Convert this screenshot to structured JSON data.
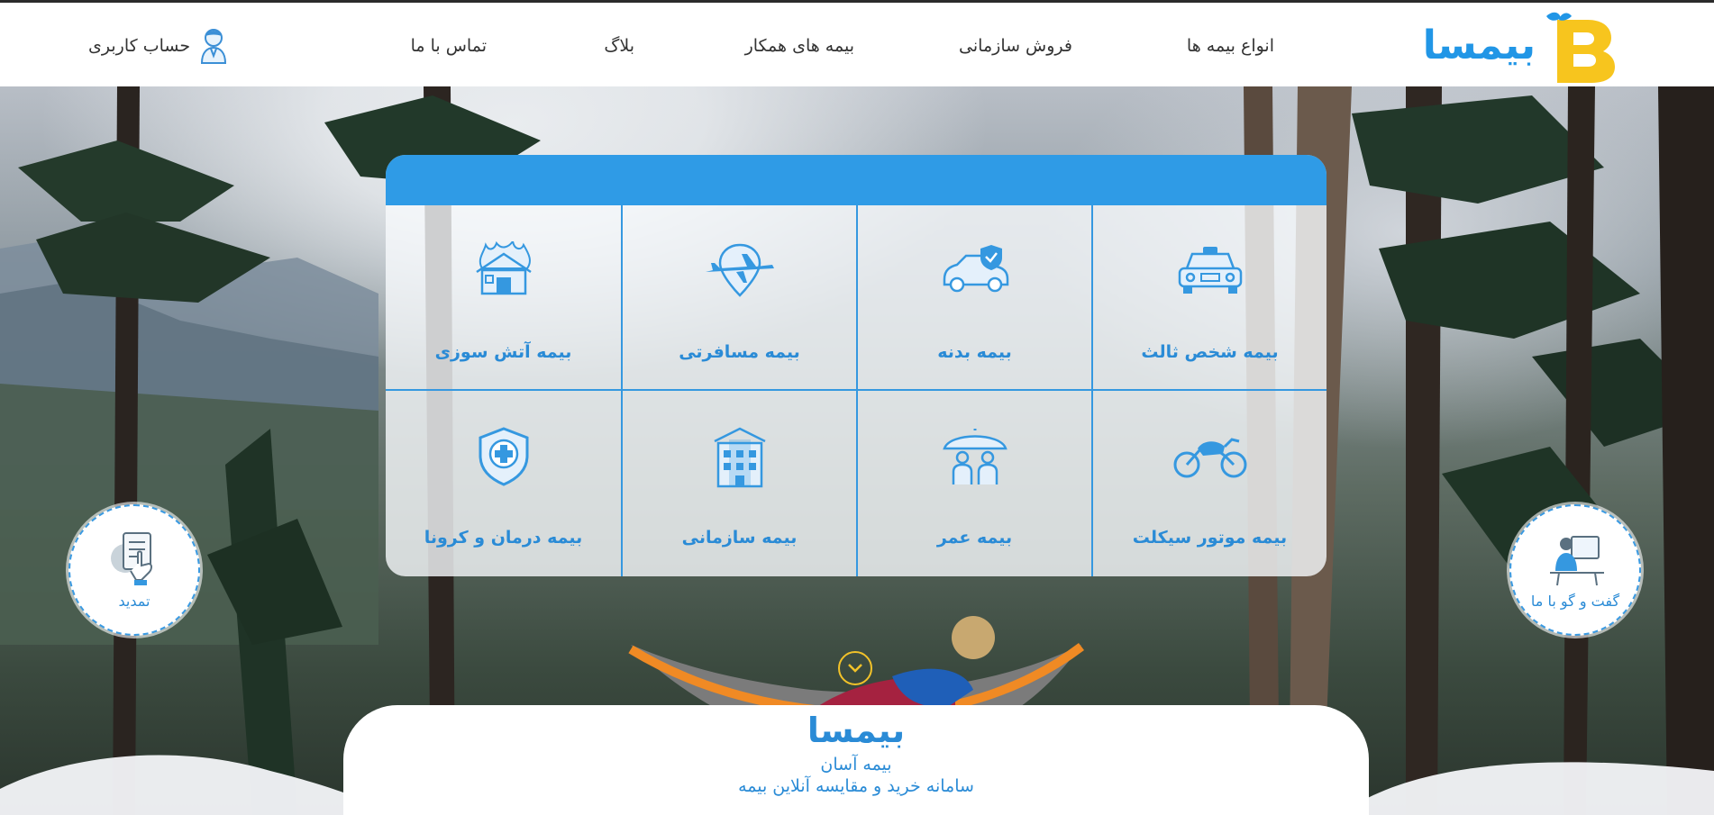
{
  "brand": {
    "name": "بیمسا"
  },
  "nav": {
    "insurance_types": "انواع بیمه ها",
    "corporate_sales": "فروش سازمانی",
    "partner_insurance": "بیمه های همکار",
    "blog": "بلاگ",
    "contact": "تماس با ما",
    "account": "حساب کاربری"
  },
  "grid": {
    "items": [
      {
        "label": "بیمه شخص ثالث",
        "icon": "car-third-party-icon"
      },
      {
        "label": "بیمه بدنه",
        "icon": "car-shield-icon"
      },
      {
        "label": "بیمه مسافرتی",
        "icon": "airplane-pin-icon"
      },
      {
        "label": "بیمه آتش سوزی",
        "icon": "house-fire-icon"
      },
      {
        "label": "بیمه موتور سیکلت",
        "icon": "motorcycle-icon"
      },
      {
        "label": "بیمه عمر",
        "icon": "family-umbrella-icon"
      },
      {
        "label": "بیمه سازمانی",
        "icon": "building-icon"
      },
      {
        "label": "بیمه درمان و کرونا",
        "icon": "health-shield-icon"
      }
    ]
  },
  "side": {
    "chat": "گفت و گو با ما",
    "renew": "تمدید"
  },
  "bottom": {
    "title": "بیمسا",
    "subtitle": "بیمه آسان",
    "description": "سامانه خرید و مقایسه آنلاین بیمه"
  },
  "colors": {
    "primary": "#2f9be6",
    "text_blue": "#2a8bd6",
    "logo_yellow": "#f7c51e",
    "accent_yellow": "#f2c229"
  }
}
